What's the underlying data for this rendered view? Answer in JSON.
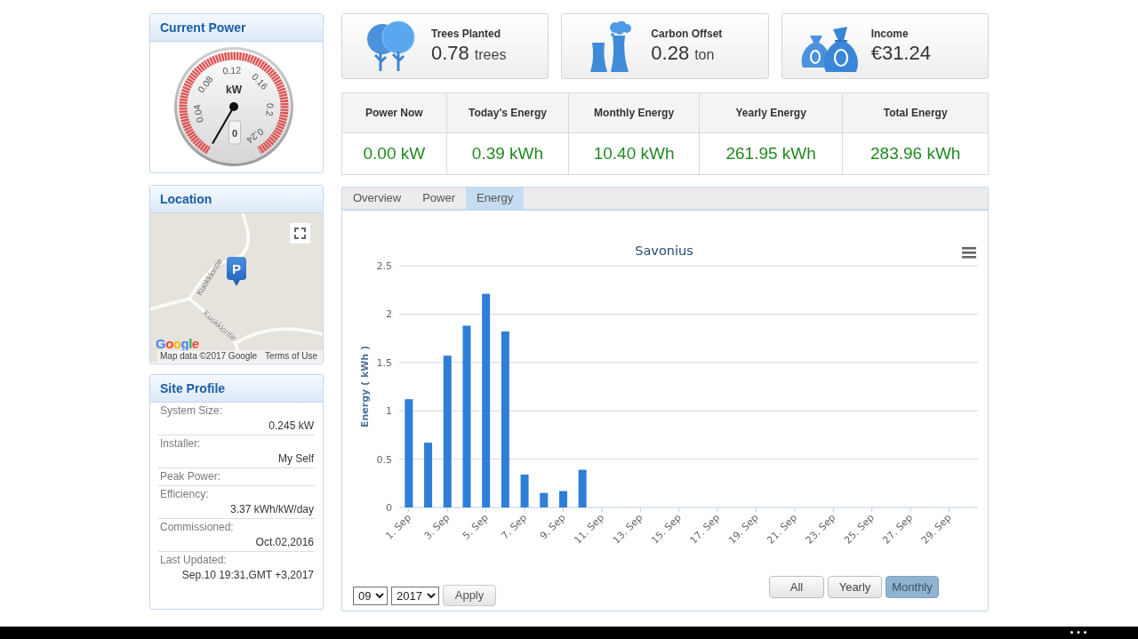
{
  "current_power": {
    "title": "Current Power",
    "gauge": {
      "scale_labels": [
        "0.04",
        "0.08",
        "0.12",
        "0.16",
        "0.2",
        "0.24"
      ],
      "unit": "kW",
      "readout": "0"
    }
  },
  "location": {
    "title": "Location",
    "map": {
      "street_labels": [
        "Kuokkiontie",
        "Kuokkiontie"
      ],
      "marker_label": "P",
      "logo": "Google",
      "attribution": "Map data ©2017 Google",
      "terms_link": "Terms of Use"
    }
  },
  "site_profile": {
    "title": "Site Profile",
    "entries": [
      {
        "kind": "label",
        "text": "System Size:"
      },
      {
        "kind": "value",
        "text": "0.245 kW"
      },
      {
        "kind": "label",
        "text": "Installer:"
      },
      {
        "kind": "value",
        "text": "My Self"
      },
      {
        "kind": "label",
        "text": "Peak Power:"
      },
      {
        "kind": "label",
        "text": "Efficiency:"
      },
      {
        "kind": "value",
        "text": "3.37 kWh/kW/day"
      },
      {
        "kind": "label",
        "text": "Commissioned:"
      },
      {
        "kind": "value",
        "text": "Oct.02,2016"
      },
      {
        "kind": "label",
        "text": "Last Updated:"
      },
      {
        "kind": "value",
        "text": "Sep.10 19:31,GMT +3,2017"
      }
    ]
  },
  "stat_cards": [
    {
      "kind": "trees",
      "label": "Trees Planted",
      "value": "0.78",
      "unit": "trees"
    },
    {
      "kind": "carbon",
      "label": "Carbon Offset",
      "value": "0.28",
      "unit": "ton"
    },
    {
      "kind": "income",
      "label": "Income",
      "value": "€31.24"
    }
  ],
  "energy_summary": [
    {
      "label": "Power Now",
      "value": "0.00 kW"
    },
    {
      "label": "Today's Energy",
      "value": "0.39 kWh"
    },
    {
      "label": "Monthly Energy",
      "value": "10.40 kWh"
    },
    {
      "label": "Yearly Energy",
      "value": "261.95 kWh"
    },
    {
      "label": "Total Energy",
      "value": "283.96 kWh"
    }
  ],
  "tabs": [
    {
      "label": "Overview",
      "selected": false
    },
    {
      "label": "Power",
      "selected": false
    },
    {
      "label": "Energy",
      "selected": true
    }
  ],
  "chart": {
    "chart_data": {
      "type": "bar",
      "title": "Savonius",
      "ylabel": "Energy ( kWh )",
      "categories": [
        "1. Sep",
        null,
        "3. Sep",
        null,
        "5. Sep",
        null,
        "7. Sep",
        null,
        "9. Sep",
        null,
        "11. Sep",
        null,
        "13. Sep",
        null,
        "15. Sep",
        null,
        "17. Sep",
        null,
        "19. Sep",
        null,
        "21. Sep",
        null,
        "23. Sep",
        null,
        "25. Sep",
        null,
        "27. Sep",
        null,
        "29. Sep",
        null
      ],
      "series": [
        {
          "color": "#2f7ed8",
          "values": [
            1.12,
            0.67,
            1.57,
            1.88,
            2.21,
            1.82,
            0.34,
            0.15,
            0.17,
            0.39,
            null,
            null,
            null,
            null,
            null,
            null,
            null,
            null,
            null,
            null,
            null,
            null,
            null,
            null,
            null,
            null,
            null,
            null,
            null,
            null
          ]
        }
      ],
      "ylim": [
        0,
        2.5
      ],
      "yticks": [
        0,
        0.5,
        1,
        1.5,
        2,
        2.5
      ],
      "grid": true
    }
  },
  "filters": {
    "month": "09",
    "year": "2017",
    "apply_button": "Apply"
  },
  "range_buttons": [
    {
      "label": "All",
      "selected": false
    },
    {
      "label": "Yearly",
      "selected": false
    },
    {
      "label": "Monthly",
      "selected": true
    }
  ]
}
